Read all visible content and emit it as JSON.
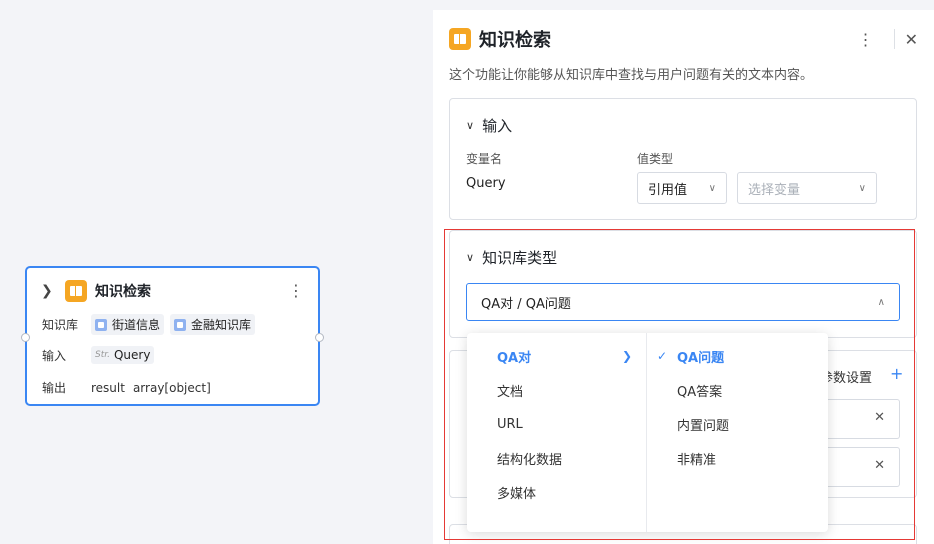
{
  "node": {
    "title": "知识检索",
    "kb_label": "知识库",
    "kb_chips": [
      "街道信息",
      "金融知识库"
    ],
    "input_label": "输入",
    "input_type": "Str.",
    "input_value": "Query",
    "output_label": "输出",
    "output_name": "result",
    "output_type": "array[object]"
  },
  "panel": {
    "title": "知识检索",
    "description": "这个功能让你能够从知识库中查找与用户问题有关的文本内容。",
    "input_section": {
      "title": "输入",
      "var_name_label": "变量名",
      "value_type_label": "值类型",
      "var_name": "Query",
      "value_type": "引用值",
      "variable_placeholder": "选择变量"
    },
    "kb_type_section": {
      "title": "知识库类型",
      "selected": "QA对 / QA问题"
    },
    "params_label": "参数设置"
  },
  "cascader": {
    "level1": [
      "QA对",
      "文档",
      "URL",
      "结构化数据",
      "多媒体"
    ],
    "level1_active": "QA对",
    "level2": [
      "QA问题",
      "QA答案",
      "内置问题",
      "非精准"
    ],
    "level2_active": "QA问题"
  },
  "colors": {
    "accent": "#3a86f3",
    "icon_orange": "#f5a623",
    "highlight_red": "#e53935"
  }
}
